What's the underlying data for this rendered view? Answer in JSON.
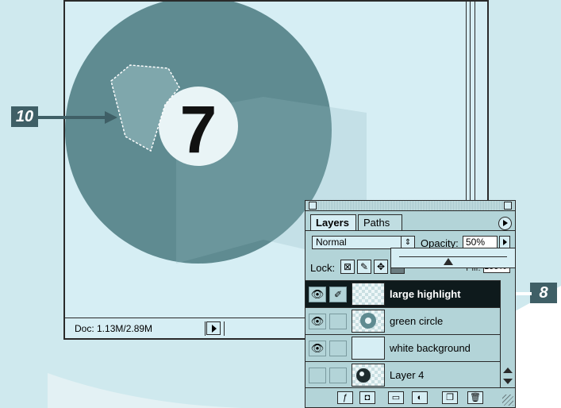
{
  "document": {
    "status": "Doc: 1.13M/2.89M"
  },
  "canvas": {
    "ball_number": "7"
  },
  "callouts": {
    "left": "10",
    "right": "8"
  },
  "layers_palette": {
    "tabs": [
      "Layers",
      "Paths"
    ],
    "blend_mode": "Normal",
    "blend_arrows": "⇕",
    "opacity_label": "Opacity:",
    "opacity_value": "50%",
    "lock_label": "Lock:",
    "fill_label": "Fill:",
    "fill_value": "100%",
    "layers": [
      {
        "name": "large highlight",
        "visible": true,
        "active": true
      },
      {
        "name": "green circle",
        "visible": true,
        "active": false
      },
      {
        "name": "white background",
        "visible": true,
        "active": false
      },
      {
        "name": "Layer 4",
        "visible": false,
        "active": false
      }
    ]
  },
  "colors": {
    "background_watermark": "#cfe9ee",
    "ball": "#5f8b91",
    "callout": "#3f5f66",
    "active_row": "#0e1a1c"
  }
}
